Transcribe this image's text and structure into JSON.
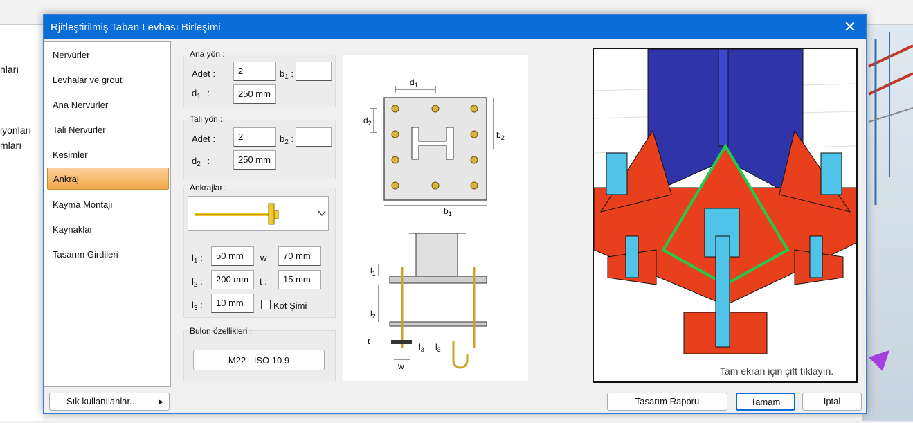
{
  "background": {
    "left_texts": [
      "nları",
      "iyonları",
      "mları"
    ]
  },
  "dialog": {
    "title": "Rjitleştirilmiş Taban Levhası Birleşimi",
    "close_glyph": "✕",
    "nav": {
      "items": [
        {
          "label": "Nervürler",
          "selected": false
        },
        {
          "label": "Levhalar ve grout",
          "selected": false
        },
        {
          "label": "Ana Nervürler",
          "selected": false
        },
        {
          "label": "Tali Nervürler",
          "selected": false
        },
        {
          "label": "Kesimler",
          "selected": false
        },
        {
          "label": "Ankraj",
          "selected": true
        },
        {
          "label": "Kayma Montajı",
          "selected": false
        },
        {
          "label": "Kaynaklar",
          "selected": false
        },
        {
          "label": "Tasarım Girdileri",
          "selected": false
        }
      ]
    },
    "ana_yon": {
      "title": "Ana yön :",
      "adet_label": "Adet :",
      "adet_value": "2",
      "b1_label": "b",
      "b1_sub": "1",
      "b1_colon": ":",
      "b1_value": "",
      "d1_label": "d",
      "d1_sub": "1",
      "d1_colon": ":",
      "d1_value": "250 mm"
    },
    "tali_yon": {
      "title": "Tali yön :",
      "adet_label": "Adet :",
      "adet_value": "2",
      "b2_label": "b",
      "b2_sub": "2",
      "b2_colon": ":",
      "b2_value": "",
      "d2_label": "d",
      "d2_sub": "2",
      "d2_colon": ":",
      "d2_value": "250 mm"
    },
    "ankrajlar": {
      "title": "Ankrajlar :",
      "l1_label": "l",
      "l1_sub": "1",
      "l1_colon": ":",
      "l1_value": "50 mm",
      "l2_label": "l",
      "l2_sub": "2",
      "l2_colon": ":",
      "l2_value": "200 mm",
      "l3_label": "l",
      "l3_sub": "3",
      "l3_colon": ":",
      "l3_value": "10 mm",
      "w_label": "w",
      "w_value": "70 mm",
      "t_label": "t :",
      "t_value": "15 mm",
      "kot_label": "Kot Şimi",
      "kot_checked": false
    },
    "bulon": {
      "title": "Bulon özellikleri :",
      "value": "M22 - ISO 10.9"
    },
    "diagram": {
      "d1": "d",
      "d1s": "1",
      "d2": "d",
      "d2s": "2",
      "b1": "b",
      "b1s": "1",
      "b2": "b",
      "b2s": "2",
      "l1": "l",
      "l1s": "1",
      "l2": "l",
      "l2s": "2",
      "l3": "l",
      "l3s": "3",
      "l3b": "l",
      "l3bs": "3",
      "t": "t",
      "w": "w"
    },
    "view3d": {
      "hint": "Tam ekran için çift tıklayın."
    },
    "footer": {
      "favorites": "Sık kullanılanlar...",
      "report": "Tasarım Raporu",
      "ok": "Tamam",
      "cancel": "İptal"
    },
    "colors": {
      "accent": "#0a6cd6",
      "plate": "#e8401c",
      "column": "#2f35a8",
      "bolt": "#4fc3e8",
      "weld": "#22c94a",
      "anchor_yellow": "#f2c82a"
    }
  }
}
